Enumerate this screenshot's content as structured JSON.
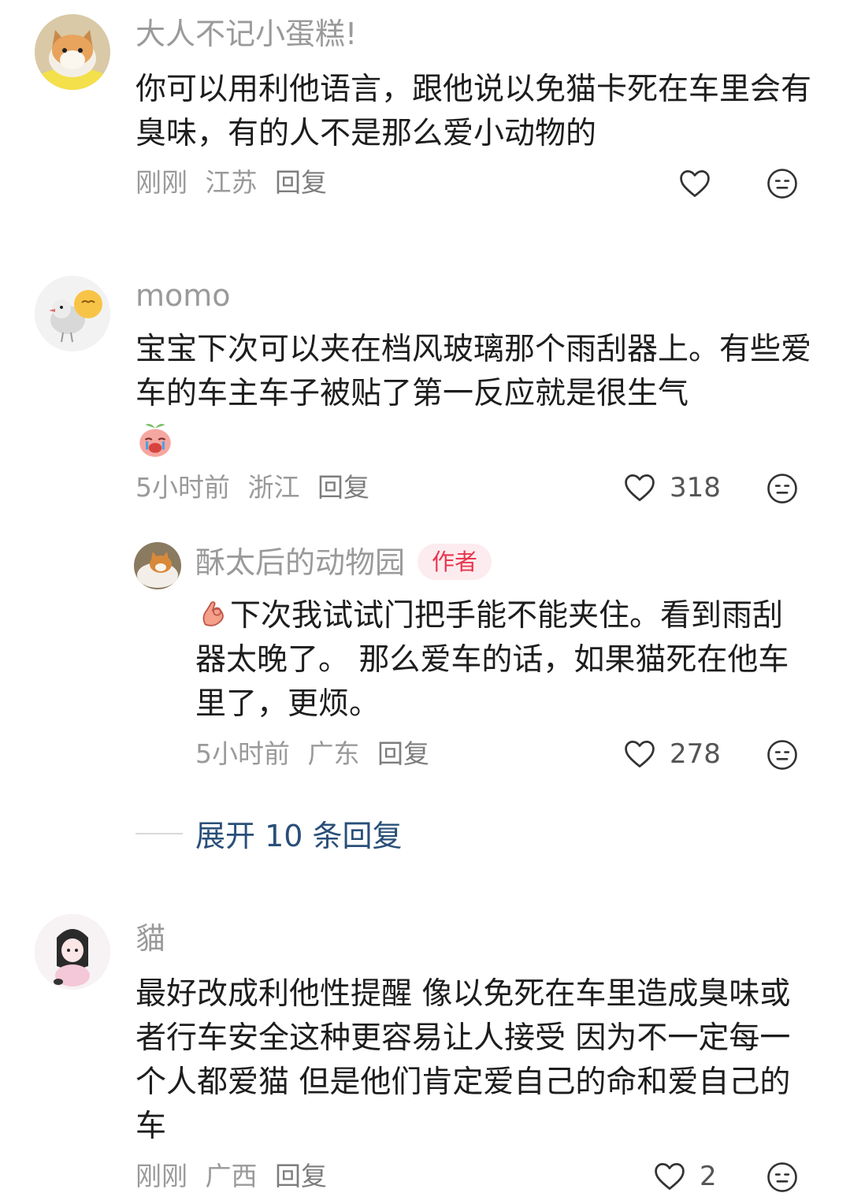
{
  "comments": [
    {
      "name": "大人不记小蛋糕!",
      "text": "你可以用利他语言，跟他说以免猫卡死在车里会有臭味，有的人不是那么爱小动物的",
      "time": "刚刚",
      "location": "江苏",
      "reply": "回复",
      "likes": ""
    },
    {
      "name": "momo",
      "text": "宝宝下次可以夹在档风玻璃那个雨刮器上。有些爱车的车主车子被贴了第一反应就是很生气",
      "time": "5小时前",
      "location": "浙江",
      "reply": "回复",
      "likes": "318"
    },
    {
      "name": "酥太后的动物园",
      "badge": "作者",
      "text": "下次我试试门把手能不能夹住。看到雨刮器太晚了。 那么爱车的话，如果猫死在他车里了，更烦。",
      "time": "5小时前",
      "location": "广东",
      "reply": "回复",
      "likes": "278"
    },
    {
      "name": "貓",
      "text": "最好改成利他性提醒 像以免死在车里造成臭味或者行车安全这种更容易让人接受 因为不一定每一个人都爱猫 但是他们肯定爱自己的命和爱自己的车",
      "time": "刚刚",
      "location": "广西",
      "reply": "回复",
      "likes": "2"
    }
  ],
  "expand_replies": "展开 10 条回复",
  "icons": {
    "like": "heart-outline-icon",
    "dislike": "meh-face-icon"
  }
}
